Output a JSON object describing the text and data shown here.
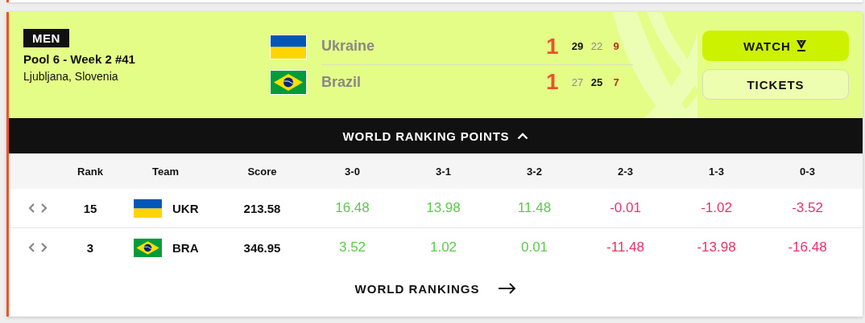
{
  "match": {
    "category": "MEN",
    "title": "Pool 6 - Week 2 #41",
    "location": "Ljubljana, Slovenia",
    "teams": [
      {
        "name": "Ukraine",
        "kind": "ukraine",
        "sets_won": "1",
        "sets": [
          {
            "score": "29",
            "kind": "won"
          },
          {
            "score": "22",
            "kind": "lost"
          },
          {
            "score": "9",
            "kind": "live"
          }
        ]
      },
      {
        "name": "Brazil",
        "kind": "brazil",
        "sets_won": "1",
        "sets": [
          {
            "score": "27",
            "kind": "lost"
          },
          {
            "score": "25",
            "kind": "won"
          },
          {
            "score": "7",
            "kind": "live"
          }
        ]
      }
    ],
    "buttons": [
      {
        "label": "WATCH",
        "kind": "primary"
      },
      {
        "label": "TICKETS",
        "kind": "outline"
      }
    ]
  },
  "ranking_points": {
    "title": "WORLD RANKING POINTS",
    "expanded": true,
    "columns": [
      "Rank",
      "Team",
      "Score",
      "3-0",
      "3-1",
      "3-2",
      "2-3",
      "1-3",
      "0-3"
    ],
    "rows": [
      {
        "rank": "15",
        "kind": "ukraine",
        "team": "UKR",
        "score": "213.58",
        "points": [
          {
            "value": "16.48",
            "kind": "gain"
          },
          {
            "value": "13.98",
            "kind": "gain"
          },
          {
            "value": "11.48",
            "kind": "gain"
          },
          {
            "value": "-0.01",
            "kind": "loss"
          },
          {
            "value": "-1.02",
            "kind": "loss"
          },
          {
            "value": "-3.52",
            "kind": "loss"
          }
        ]
      },
      {
        "rank": "3",
        "kind": "brazil",
        "team": "BRA",
        "score": "346.95",
        "points": [
          {
            "value": "3.52",
            "kind": "gain"
          },
          {
            "value": "1.02",
            "kind": "gain"
          },
          {
            "value": "0.01",
            "kind": "gain"
          },
          {
            "value": "-11.48",
            "kind": "loss"
          },
          {
            "value": "-13.98",
            "kind": "loss"
          },
          {
            "value": "-16.48",
            "kind": "loss"
          }
        ]
      }
    ]
  },
  "footer_link": "WORLD RANKINGS"
}
